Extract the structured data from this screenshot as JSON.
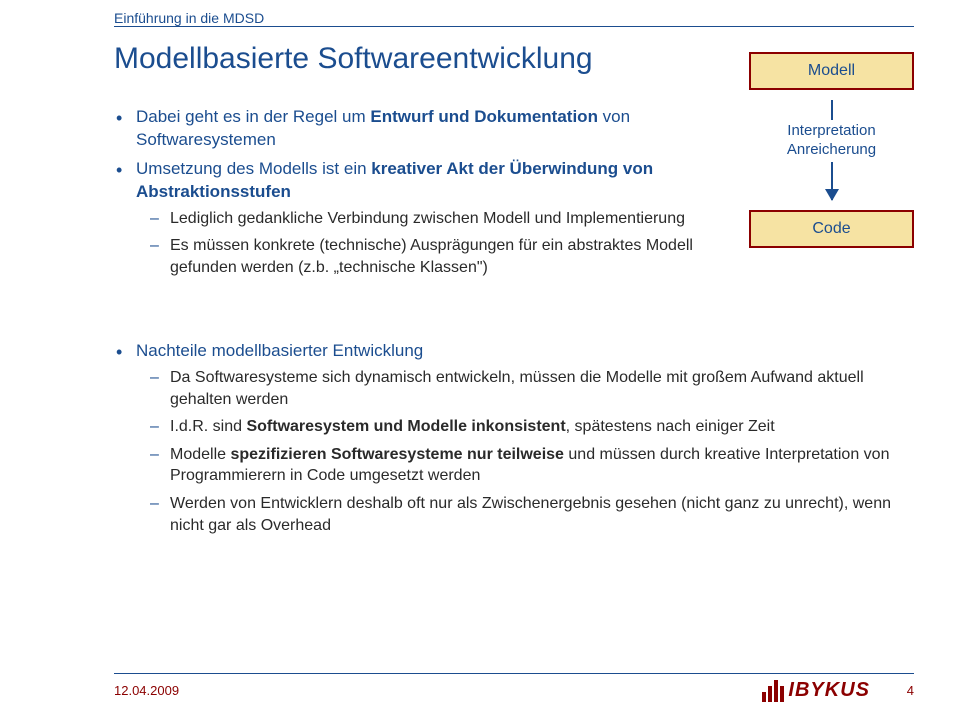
{
  "breadcrumb": "Einführung in die MDSD",
  "title": "Modellbasierte Softwareentwicklung",
  "bullets_top": [
    {
      "text_plain": "Dabei geht es in der Regel um ",
      "text_bold": "Entwurf und Dokumentation",
      "text_tail": " von Softwaresystemen"
    },
    {
      "text_plain": "Umsetzung des Modells ist ein ",
      "text_bold": "kreativer Akt der Überwindung von Abstraktionsstufen",
      "text_tail": ""
    }
  ],
  "dashes_top": [
    "Lediglich gedankliche Verbindung zwischen Modell und Implementierung",
    "Es müssen konkrete (technische) Ausprägungen für ein abstraktes Modell gefunden werden (z.b. „technische Klassen\")"
  ],
  "bullet_wide_label": "Nachteile modellbasierter Entwicklung",
  "dashes_wide": [
    {
      "pre": "Da Softwaresysteme sich dynamisch entwickeln, müssen die Modelle mit großem Aufwand aktuell gehalten werden",
      "bold": "",
      "post": ""
    },
    {
      "pre": "I.d.R. sind ",
      "bold": "Softwaresystem und Modelle inkonsistent",
      "post": ", spätestens nach einiger Zeit"
    },
    {
      "pre": "Modelle ",
      "bold": "spezifizieren Softwaresysteme nur teilweise",
      "post": " und müssen durch kreative Interpretation von Programmierern in Code umgesetzt werden"
    },
    {
      "pre": "Werden von Entwicklern deshalb oft nur als Zwischenergebnis gesehen (nicht ganz zu unrecht), wenn nicht gar als Overhead",
      "bold": "",
      "post": ""
    }
  ],
  "diagram": {
    "box_top": "Modell",
    "arrow_label_line1": "Interpretation",
    "arrow_label_line2": "Anreicherung",
    "box_bottom": "Code"
  },
  "footer": {
    "date": "12.04.2009",
    "page": "4",
    "logo_text": "IBYKUS"
  }
}
